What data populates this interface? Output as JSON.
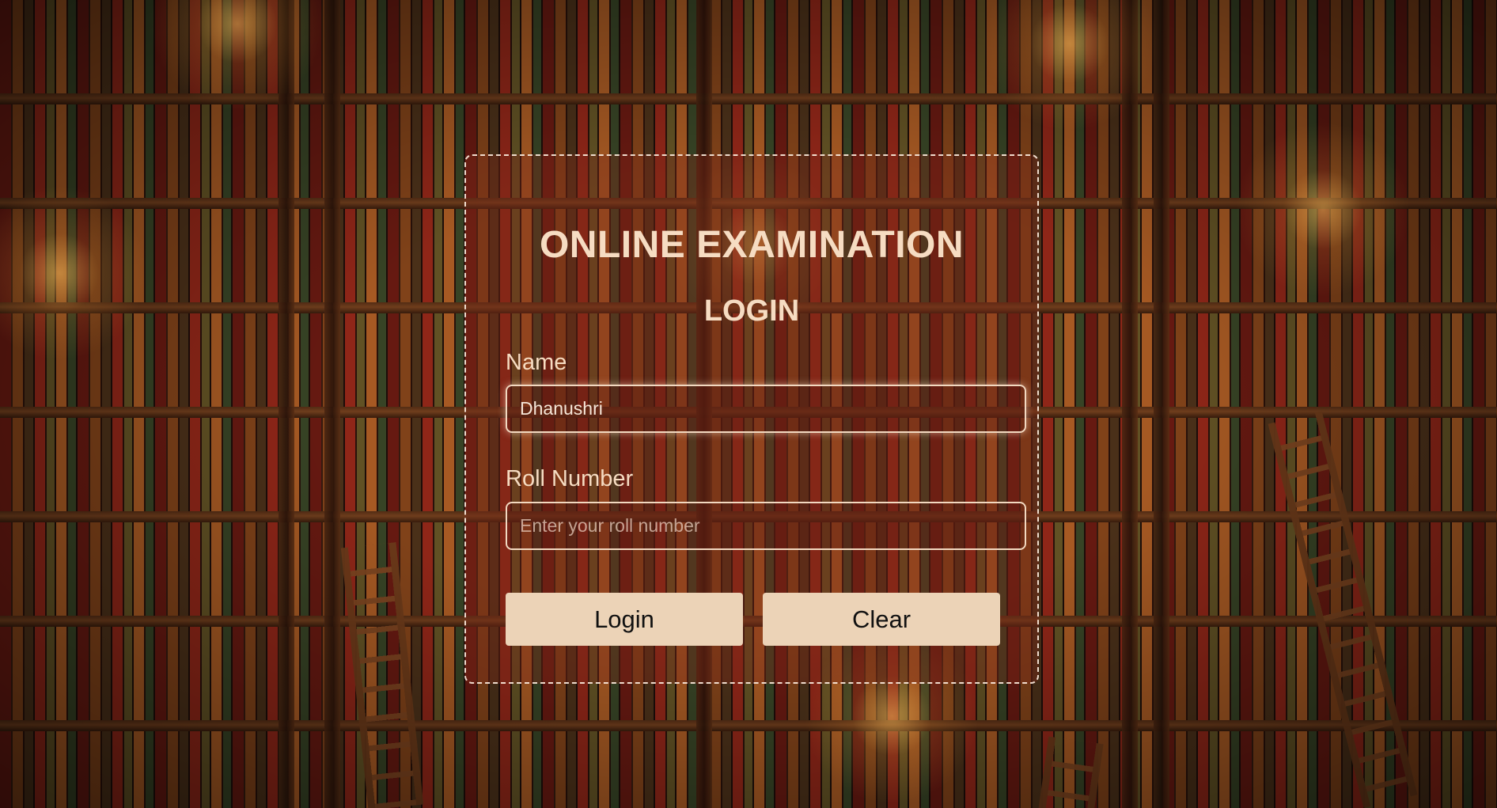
{
  "page": {
    "title": "ONLINE EXAMINATION",
    "subtitle": "LOGIN"
  },
  "form": {
    "name_label": "Name",
    "name_value": "Dhanushri",
    "roll_label": "Roll Number",
    "roll_placeholder": "Enter your roll number",
    "roll_value": ""
  },
  "buttons": {
    "login_label": "Login",
    "clear_label": "Clear"
  },
  "colors": {
    "heading_text": "#f6dcc2",
    "button_bg": "#ecd3b7",
    "card_border": "#fff0e1"
  },
  "icons": {
    "background": "library-bookshelf-image"
  }
}
